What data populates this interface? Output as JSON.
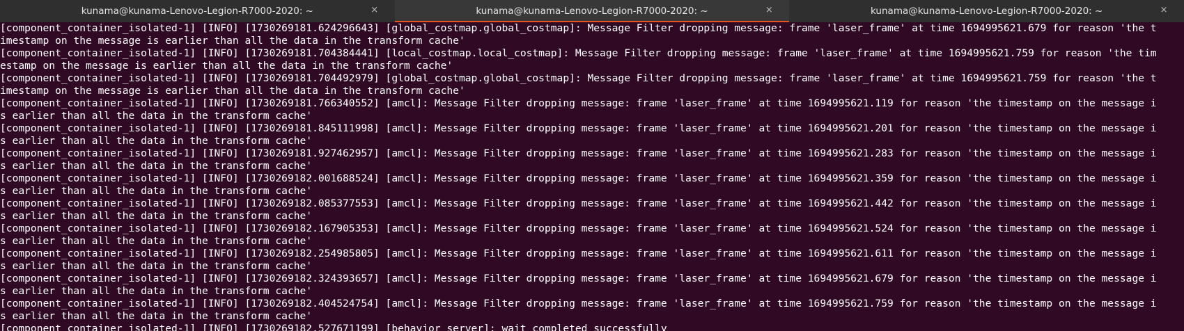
{
  "tabs": [
    {
      "title": "kunama@kunama-Lenovo-Legion-R7000-2020: ~",
      "close": "×"
    },
    {
      "title": "kunama@kunama-Lenovo-Legion-R7000-2020: ~",
      "close": "×"
    },
    {
      "title": "kunama@kunama-Lenovo-Legion-R7000-2020: ~",
      "close": "×"
    }
  ],
  "colors": {
    "terminal_bg": "#300a24",
    "terminal_fg": "#ffffff",
    "tab_accent": "#e95420"
  },
  "terminal": {
    "lines": [
      "[component_container_isolated-1] [INFO] [1730269181.624296643] [global_costmap.global_costmap]: Message Filter dropping message: frame 'laser_frame' at time 1694995621.679 for reason 'the t",
      "imestamp on the message is earlier than all the data in the transform cache'",
      "[component_container_isolated-1] [INFO] [1730269181.704384441] [local_costmap.local_costmap]: Message Filter dropping message: frame 'laser_frame' at time 1694995621.759 for reason 'the tim",
      "estamp on the message is earlier than all the data in the transform cache'",
      "[component_container_isolated-1] [INFO] [1730269181.704492979] [global_costmap.global_costmap]: Message Filter dropping message: frame 'laser_frame' at time 1694995621.759 for reason 'the t",
      "imestamp on the message is earlier than all the data in the transform cache'",
      "[component_container_isolated-1] [INFO] [1730269181.766340552] [amcl]: Message Filter dropping message: frame 'laser_frame' at time 1694995621.119 for reason 'the timestamp on the message i",
      "s earlier than all the data in the transform cache'",
      "[component_container_isolated-1] [INFO] [1730269181.845111998] [amcl]: Message Filter dropping message: frame 'laser_frame' at time 1694995621.201 for reason 'the timestamp on the message i",
      "s earlier than all the data in the transform cache'",
      "[component_container_isolated-1] [INFO] [1730269181.927462957] [amcl]: Message Filter dropping message: frame 'laser_frame' at time 1694995621.283 for reason 'the timestamp on the message i",
      "s earlier than all the data in the transform cache'",
      "[component_container_isolated-1] [INFO] [1730269182.001688524] [amcl]: Message Filter dropping message: frame 'laser_frame' at time 1694995621.359 for reason 'the timestamp on the message i",
      "s earlier than all the data in the transform cache'",
      "[component_container_isolated-1] [INFO] [1730269182.085377553] [amcl]: Message Filter dropping message: frame 'laser_frame' at time 1694995621.442 for reason 'the timestamp on the message i",
      "s earlier than all the data in the transform cache'",
      "[component_container_isolated-1] [INFO] [1730269182.167905353] [amcl]: Message Filter dropping message: frame 'laser_frame' at time 1694995621.524 for reason 'the timestamp on the message i",
      "s earlier than all the data in the transform cache'",
      "[component_container_isolated-1] [INFO] [1730269182.254985805] [amcl]: Message Filter dropping message: frame 'laser_frame' at time 1694995621.611 for reason 'the timestamp on the message i",
      "s earlier than all the data in the transform cache'",
      "[component_container_isolated-1] [INFO] [1730269182.324393657] [amcl]: Message Filter dropping message: frame 'laser_frame' at time 1694995621.679 for reason 'the timestamp on the message i",
      "s earlier than all the data in the transform cache'",
      "[component_container_isolated-1] [INFO] [1730269182.404524754] [amcl]: Message Filter dropping message: frame 'laser_frame' at time 1694995621.759 for reason 'the timestamp on the message i",
      "s earlier than all the data in the transform cache'",
      "[component_container_isolated-1] [INFO] [1730269182.527671199] [behavior_server]: wait completed successfully"
    ]
  }
}
